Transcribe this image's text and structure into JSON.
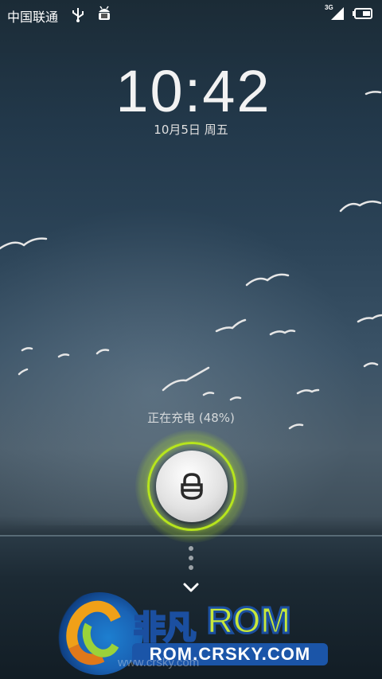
{
  "status_bar": {
    "carrier": "中国联通",
    "network_type": "3G",
    "icons": [
      "usb-icon",
      "android-debug-icon",
      "signal-icon",
      "battery-icon"
    ]
  },
  "lockscreen": {
    "time": "10:42",
    "date": "10月5日 周五",
    "charging_status": "正在充电 (48%)",
    "battery_percent": 48,
    "unlock_icon": "lock-icon",
    "swipe_hint_icon": "chevron-down-icon"
  },
  "watermark": {
    "brand_cn": "非凡",
    "brand_rom": "ROM",
    "url": "ROM.CRSKY.COM",
    "faint_text": "www.crsky.com"
  },
  "colors": {
    "accent_ring": "#b7e51d",
    "logo_blue": "#1b55a8"
  }
}
